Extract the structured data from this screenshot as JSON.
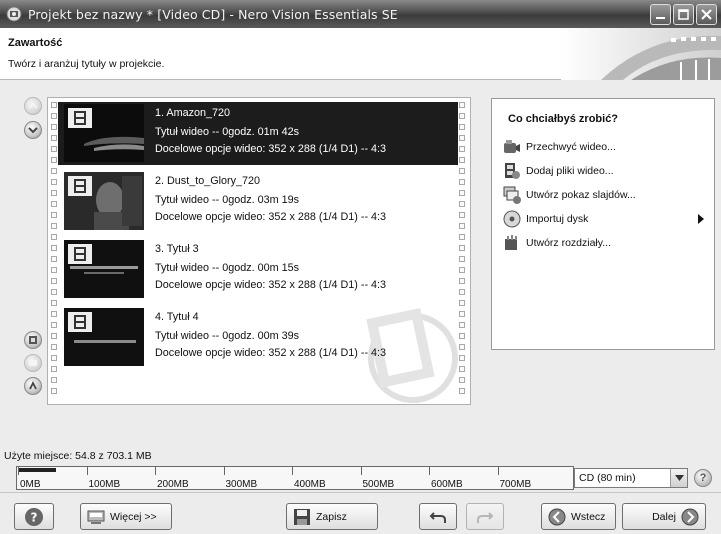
{
  "window": {
    "title": "Projekt bez nazwy * [Video CD] - Nero Vision Essentials SE"
  },
  "header": {
    "title": "Zawartość",
    "subtitle": "Twórz i aranżuj tytuły w projekcie."
  },
  "titles": [
    {
      "name": "1. Amazon_720",
      "info": "Tytuł wideo -- 0godz. 01m 42s",
      "options": "Docelowe opcje wideo: 352 x 288 (1/4 D1) -- 4:3",
      "selected": true
    },
    {
      "name": "2. Dust_to_Glory_720",
      "info": "Tytuł wideo -- 0godz. 03m 19s",
      "options": "Docelowe opcje wideo: 352 x 288 (1/4 D1) -- 4:3",
      "selected": false
    },
    {
      "name": "3. Tytuł 3",
      "info": "Tytuł wideo -- 0godz. 00m 15s",
      "options": "Docelowe opcje wideo: 352 x 288 (1/4 D1) -- 4:3",
      "selected": false
    },
    {
      "name": "4. Tytuł 4",
      "info": "Tytuł wideo -- 0godz. 00m 39s",
      "options": "Docelowe opcje wideo: 352 x 288 (1/4 D1) -- 4:3",
      "selected": false
    }
  ],
  "actions": {
    "title": "Co chciałbyś zrobić?",
    "items": [
      {
        "label": "Przechwyć wideo...",
        "icon": "camcorder-icon"
      },
      {
        "label": "Dodaj pliki wideo...",
        "icon": "film-add-icon"
      },
      {
        "label": "Utwórz pokaz slajdów...",
        "icon": "slideshow-icon"
      },
      {
        "label": "Importuj dysk",
        "icon": "disc-icon",
        "submenu": true
      },
      {
        "label": "Utwórz rozdziały...",
        "icon": "chapters-icon"
      }
    ]
  },
  "usage": {
    "label": "Użyte miejsce: 54.8 z 703.1 MB",
    "used_fraction": 0.078,
    "ticks": [
      "0MB",
      "100MB",
      "200MB",
      "300MB",
      "400MB",
      "500MB",
      "600MB",
      "700MB"
    ],
    "disc_value": "CD (80 min)"
  },
  "buttons": {
    "more": "Więcej >>",
    "save": "Zapisz",
    "back": "Wstecz",
    "next": "Dalej"
  }
}
